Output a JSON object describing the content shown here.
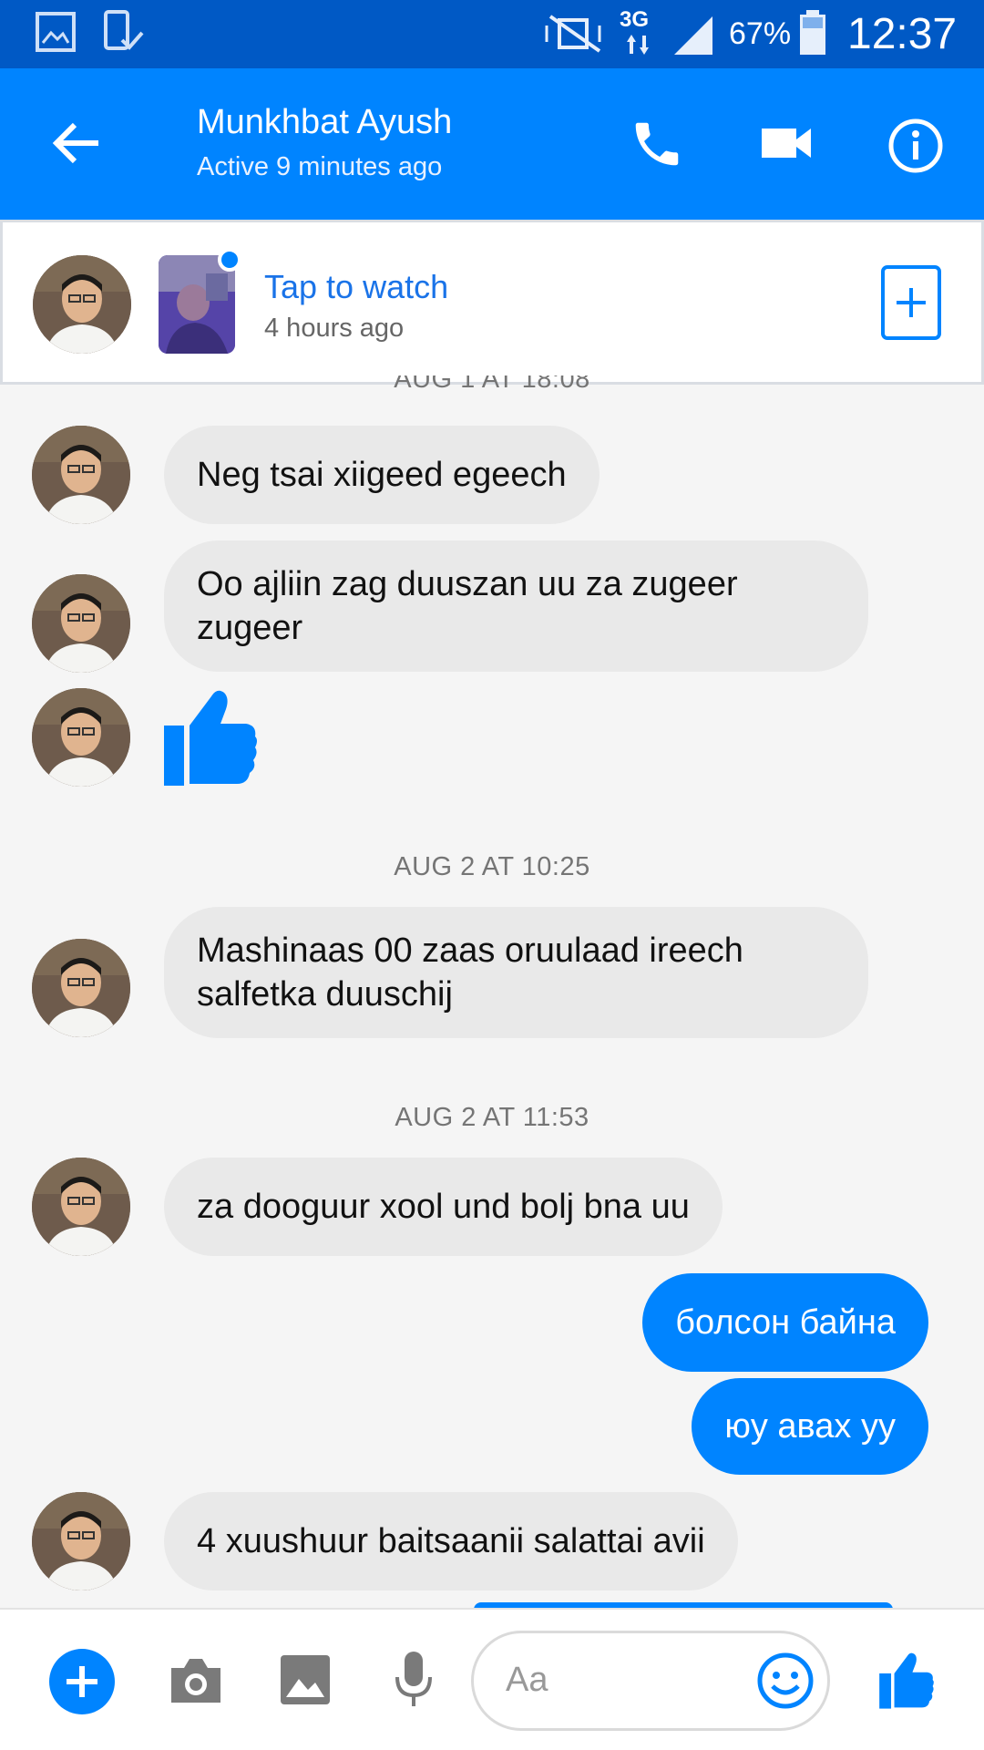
{
  "status_bar": {
    "network": "3G",
    "battery": "67%",
    "time": "12:37"
  },
  "header": {
    "contact_name": "Munkhbat Ayush",
    "contact_status": "Active 9 minutes ago"
  },
  "story": {
    "title": "Tap to watch",
    "time": "4 hours ago"
  },
  "conversation": {
    "timestamp_top_partial": "AUG 1 AT 18:08",
    "messages_day1": [
      {
        "text": "Neg tsai xiigeed egeech"
      },
      {
        "text": "Oo ajliin zag duuszan uu za zugeer zugeer"
      }
    ],
    "timestamp_2": "AUG 2 AT 10:25",
    "message_3": {
      "text": "Mashinaas 00 zaas oruulaad ireech salfetka duuschij"
    },
    "timestamp_3": "AUG 2 AT 11:53",
    "message_4": {
      "text": "za dooguur xool und bolj bna uu"
    },
    "outgoing": [
      {
        "text": "болсон байна"
      },
      {
        "text": "юу авах уу"
      }
    ],
    "message_5": {
      "text": "4 xuushuur baitsaanii salattai avii"
    }
  },
  "composer": {
    "placeholder": "Aa"
  },
  "icons": {
    "back": "back-arrow-icon",
    "call": "phone-icon",
    "video": "video-camera-icon",
    "info": "info-icon",
    "add": "plus-icon",
    "camera": "camera-icon",
    "gallery": "image-icon",
    "mic": "microphone-icon",
    "emoji": "emoji-icon",
    "like": "thumbs-up-icon"
  },
  "colors": {
    "accent": "#0084ff",
    "status_bar": "#0059c5",
    "bubble_in": "#e9e9e9"
  }
}
